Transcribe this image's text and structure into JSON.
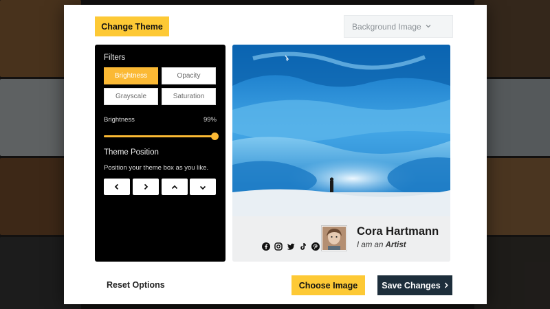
{
  "header": {
    "change_theme_label": "Change Theme",
    "background_select_value": "Background Image"
  },
  "filters": {
    "heading": "Filters",
    "buttons": [
      {
        "label": "Brightness",
        "active": true
      },
      {
        "label": "Opacity",
        "active": false
      },
      {
        "label": "Grayscale",
        "active": false
      },
      {
        "label": "Saturation",
        "active": false
      }
    ],
    "slider": {
      "label": "Brightness",
      "value_text": "99%",
      "value": 0.99
    }
  },
  "position": {
    "heading": "Theme Position",
    "hint": "Position your theme box as you like.",
    "buttons": [
      "chevron-left-icon",
      "chevron-right-icon",
      "chevron-up-icon",
      "chevron-down-icon"
    ]
  },
  "profile": {
    "name": "Cora Hartmann",
    "tagline_prefix": "I am an",
    "tagline_role": "Artist",
    "socials": [
      "facebook-icon",
      "instagram-icon",
      "twitter-icon",
      "tiktok-icon",
      "pinterest-icon"
    ]
  },
  "footer": {
    "reset_label": "Reset Options",
    "choose_label": "Choose Image",
    "save_label": "Save Changes"
  },
  "colors": {
    "accent": "#fdc935",
    "active_filter": "#fbb934",
    "save_button": "#1d2e3b",
    "panel": "#000000"
  }
}
